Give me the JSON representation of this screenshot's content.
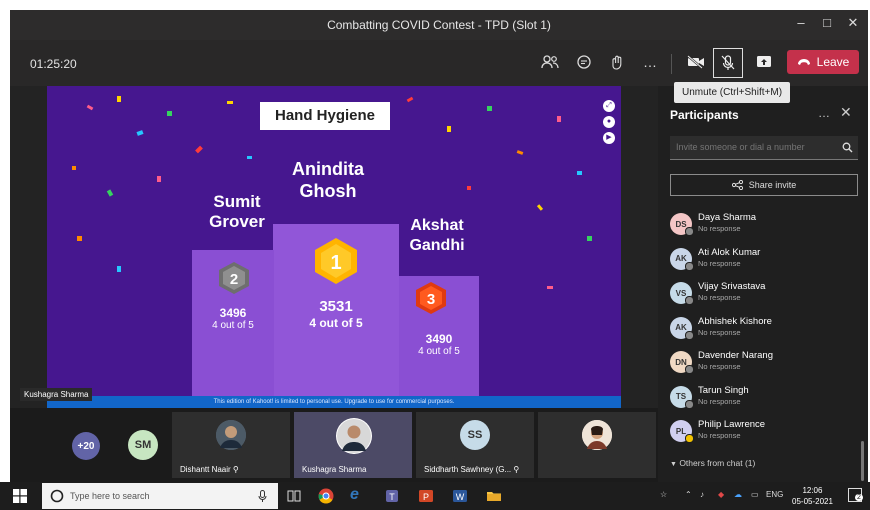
{
  "window": {
    "title": "Combatting COVID Contest - TPD (Slot 1)",
    "minimize_icon": "minimize-icon",
    "maximize_icon": "maximize-icon",
    "close_icon": "close-icon"
  },
  "toolbar": {
    "timer": "01:25:20",
    "leave_label": "Leave",
    "tooltip": "Unmute (Ctrl+Shift+M)",
    "more_label": "…",
    "accent_leave": "#c4314b"
  },
  "slide": {
    "title": "Hand Hygiene",
    "bg_color": "#46178f",
    "first": {
      "rank": "1",
      "name_line1": "Anindita",
      "name_line2": "Ghosh",
      "score": "3531",
      "detail": "4 out of 5"
    },
    "second": {
      "rank": "2",
      "name_line1": "Sumit",
      "name_line2": "Grover",
      "score": "3496",
      "detail": "4 out of 5"
    },
    "third": {
      "rank": "3",
      "name_line1": "Akshat",
      "name_line2": "Gandhi",
      "score": "3490",
      "detail": "4 out of 5"
    },
    "banner": "This edition of Kahoot! is limited to personal use. Upgrade to use for commercial purposes.",
    "presenter": "Kushagra Sharma"
  },
  "participants": {
    "title": "Participants",
    "more": "…",
    "invite_placeholder": "Invite someone or dial a number",
    "share_label": "Share invite",
    "items": [
      {
        "initials": "DS",
        "name": "Daya Sharma",
        "status": "No response",
        "color": "#f4c6c6"
      },
      {
        "initials": "AK",
        "name": "Ati Alok Kumar",
        "status": "No response",
        "color": "#c9d6e8"
      },
      {
        "initials": "VS",
        "name": "Vijay Srivastava",
        "status": "No response",
        "color": "#c6dbe8"
      },
      {
        "initials": "AK",
        "name": "Abhishek Kishore",
        "status": "No response",
        "color": "#c9d6e8"
      },
      {
        "initials": "DN",
        "name": "Davender Narang",
        "status": "No response",
        "color": "#f0d9c4"
      },
      {
        "initials": "TS",
        "name": "Tarun Singh",
        "status": "No response",
        "color": "#c6dbe8"
      },
      {
        "initials": "PL",
        "name": "Philip Lawrence",
        "status": "No response",
        "color": "#d1cff0"
      }
    ],
    "chat_section": "Others from chat (1)"
  },
  "strip": {
    "overflow": "+20",
    "sm_initials": "SM",
    "tiles": [
      {
        "label": "Dishantt Naair"
      },
      {
        "label": "Kushagra Sharma"
      },
      {
        "label": "Siddharth Sawhney (G...",
        "initials": "SS"
      },
      {
        "label": ""
      }
    ]
  },
  "taskbar": {
    "search_placeholder": "Type here to search",
    "lang": "ENG",
    "time": "12:06",
    "date": "05-05-2021",
    "notif_count": "2"
  }
}
